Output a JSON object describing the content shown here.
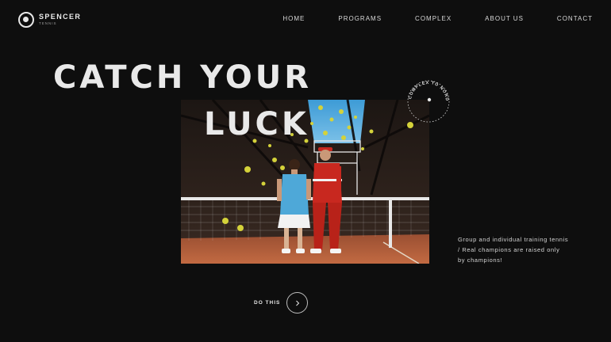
{
  "brand": {
    "name": "SPENCER",
    "sub": "TENNIS"
  },
  "nav": {
    "items": [
      {
        "label": "HOME"
      },
      {
        "label": "PROGRAMS"
      },
      {
        "label": "COMPLEX"
      },
      {
        "label": "ABOUT US"
      },
      {
        "label": "CONTACT"
      }
    ]
  },
  "hero": {
    "headline_line1": "CATCH YOUR",
    "headline_line2": "LUCK",
    "badge_text": "COMPLEX TO NORD",
    "description": "Group and individual training tennis / Real champions are raised only by champions!",
    "cta_label": "DO THIS"
  },
  "colors": {
    "background": "#0e0e0e",
    "text": "#e9e9e9",
    "ball": "#d4d23a",
    "court_clay": "#b45a35",
    "outfit_blue": "#4ea8d8",
    "outfit_red": "#c8281f"
  },
  "icons": {
    "cta": "chevron-right-icon",
    "logo": "tennis-ball-logo-icon"
  }
}
